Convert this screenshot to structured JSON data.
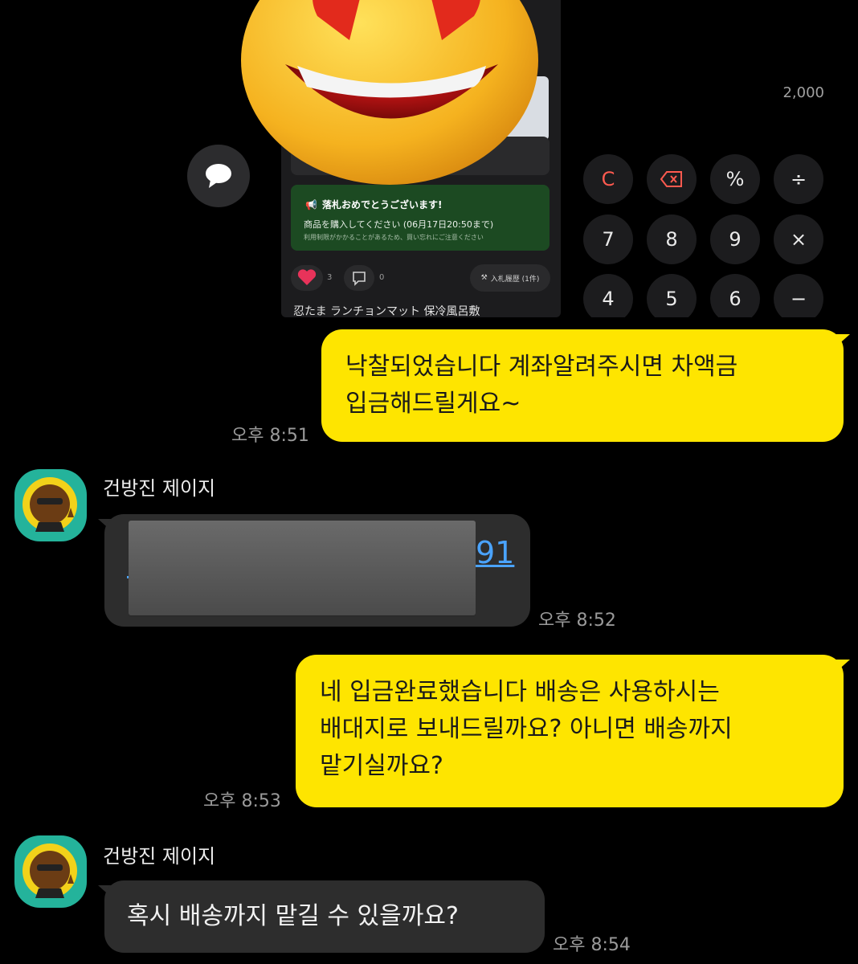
{
  "shared_screenshot": {
    "auction": {
      "win_title": "落札おめでとうございます!",
      "win_line1": "商品を購入してください (06月17日20:50まで)",
      "win_line2": "利用制限がかかることがあるため、買い忘れにご注意ください",
      "like_count": "3",
      "comment_count": "0",
      "bid_history_label": "入札履歴 (1件)",
      "title_fragment": "忍たま ランチョンマット 保冷風呂敷"
    },
    "calculator": {
      "display": "2,000",
      "keys_row1": [
        "C",
        "⌫",
        "%",
        "÷"
      ],
      "keys_row2": [
        "7",
        "8",
        "9",
        "×"
      ],
      "keys_row3": [
        "4",
        "5",
        "6",
        "−"
      ]
    }
  },
  "messages": [
    {
      "sender": "me",
      "text_lines": [
        "낙찰되었습니다 계좌알려주시면 차액금",
        "입금해드릴게요~"
      ],
      "time": "오후 8:51"
    },
    {
      "sender": "건방진 제이지",
      "link_tail": "91",
      "time": "오후 8:52"
    },
    {
      "sender": "me",
      "text_lines": [
        "네 입금완료했습니다 배송은 사용하시는",
        "배대지로 보내드릴까요? 아니면 배송까지",
        "맡기실까요?"
      ],
      "time": "오후 8:53"
    },
    {
      "sender": "건방진 제이지",
      "text": "혹시 배송까지 맡길 수 있을까요?",
      "time": "오후 8:54"
    }
  ],
  "colors": {
    "my_bubble": "#fee500",
    "their_bubble": "#2d2d2d",
    "link": "#4aa3ff",
    "avatar_bg": "#24b39b"
  }
}
